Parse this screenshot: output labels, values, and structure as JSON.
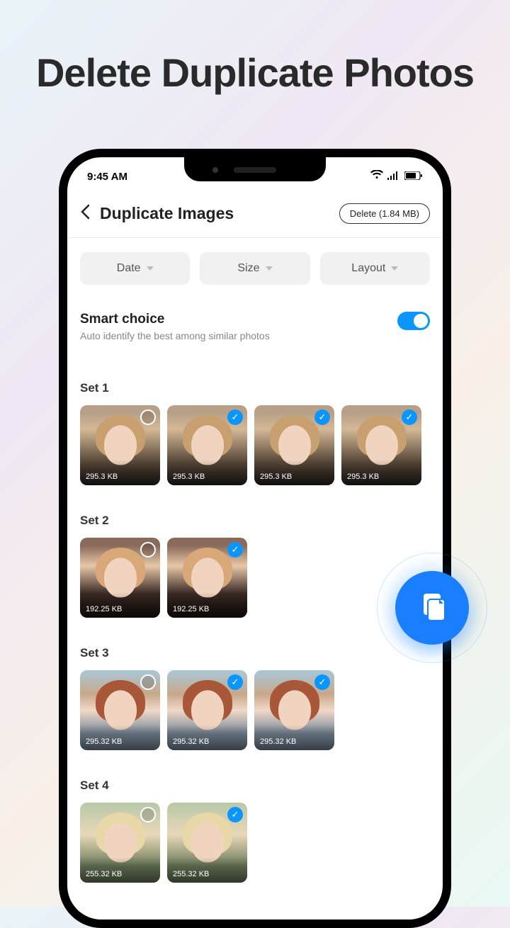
{
  "headline": "Delete Duplicate Photos",
  "statusbar": {
    "time": "9:45 AM"
  },
  "appbar": {
    "title": "Duplicate Images",
    "delete_label": "Delete (1.84 MB)"
  },
  "filters": [
    {
      "label": "Date"
    },
    {
      "label": "Size"
    },
    {
      "label": "Layout"
    }
  ],
  "smart": {
    "title": "Smart choice",
    "subtitle": "Auto identify the best among similar photos",
    "enabled": true
  },
  "sets": [
    {
      "label": "Set 1",
      "photos": [
        {
          "size": "295.3 KB",
          "selected": false
        },
        {
          "size": "295.3 KB",
          "selected": true
        },
        {
          "size": "295.3 KB",
          "selected": true
        },
        {
          "size": "295.3 KB",
          "selected": true
        }
      ]
    },
    {
      "label": "Set 2",
      "photos": [
        {
          "size": "192.25 KB",
          "selected": false
        },
        {
          "size": "192.25 KB",
          "selected": true
        }
      ]
    },
    {
      "label": "Set 3",
      "photos": [
        {
          "size": "295.32 KB",
          "selected": false
        },
        {
          "size": "295.32 KB",
          "selected": true
        },
        {
          "size": "295.32 KB",
          "selected": true
        }
      ]
    },
    {
      "label": "Set 4",
      "photos": [
        {
          "size": "255.32 KB",
          "selected": false
        },
        {
          "size": "255.32 KB",
          "selected": true
        }
      ]
    }
  ]
}
